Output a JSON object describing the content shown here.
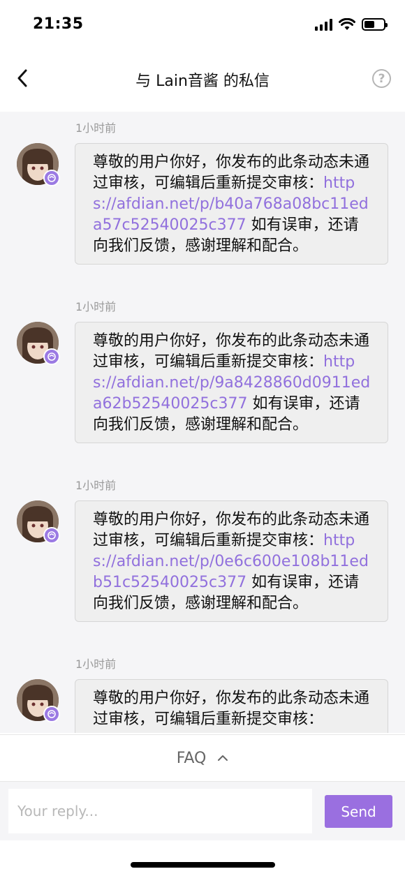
{
  "status_bar": {
    "time": "21:35"
  },
  "nav": {
    "title": "与 Lain音酱 的私信",
    "help_label": "?"
  },
  "messages": [
    {
      "timestamp": "1小时前",
      "text_before": "尊敬的用户你好，你发布的此条动态未通过审核，可编辑后重新提交审核：",
      "link": "https://afdian.net/p/b40a768a08bc11eda57c52540025c377",
      "text_after": " 如有误审，还请向我们反馈，感谢理解和配合。"
    },
    {
      "timestamp": "1小时前",
      "text_before": "尊敬的用户你好，你发布的此条动态未通过审核，可编辑后重新提交审核：",
      "link": "https://afdian.net/p/9a8428860d0911eda62b52540025c377",
      "text_after": " 如有误审，还请向我们反馈，感谢理解和配合。"
    },
    {
      "timestamp": "1小时前",
      "text_before": "尊敬的用户你好，你发布的此条动态未通过审核，可编辑后重新提交审核：",
      "link": "https://afdian.net/p/0e6c600e108b11edb51c52540025c377",
      "text_after": " 如有误审，还请向我们反馈，感谢理解和配合。"
    },
    {
      "timestamp": "1小时前",
      "text_before": "尊敬的用户你好，你发布的此条动态未通过审核，可编辑后重新提交审核：",
      "link": "",
      "text_after": ""
    }
  ],
  "faq": {
    "label": "FAQ"
  },
  "reply": {
    "placeholder": "Your reply...",
    "send_label": "Send"
  },
  "colors": {
    "accent": "#9a6fe0",
    "link": "#9170dd",
    "chat_bg": "#f5f5f7",
    "bubble_bg": "#efefef"
  }
}
